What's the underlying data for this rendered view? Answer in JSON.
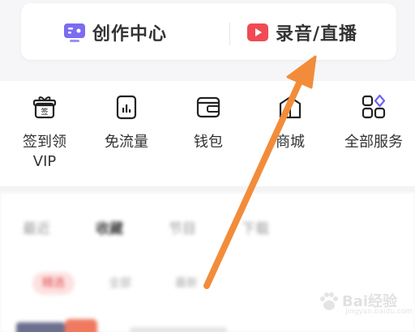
{
  "top_card": {
    "create_center": "创作中心",
    "record_live": "录音/直播",
    "colors": {
      "create_icon": "#7b6cf0",
      "live_icon": "#f04a55"
    }
  },
  "menu": {
    "items": [
      {
        "label": "签到领\nVIP",
        "icon": "gift-icon"
      },
      {
        "label": "免流量",
        "icon": "data-saver-icon"
      },
      {
        "label": "钱包",
        "icon": "wallet-icon"
      },
      {
        "label": "商城",
        "icon": "shop-icon"
      },
      {
        "label": "全部服务",
        "icon": "all-services-icon"
      }
    ]
  },
  "lower": {
    "tabs": [
      "最近",
      "收藏",
      "节目",
      "下载"
    ],
    "chips": [
      "精选",
      "全部",
      "最新"
    ]
  },
  "overlay": {
    "arrow_color": "#f28c3a"
  },
  "watermark": {
    "brand": "Bai经验",
    "sub": "jingyan.baidu.com"
  }
}
